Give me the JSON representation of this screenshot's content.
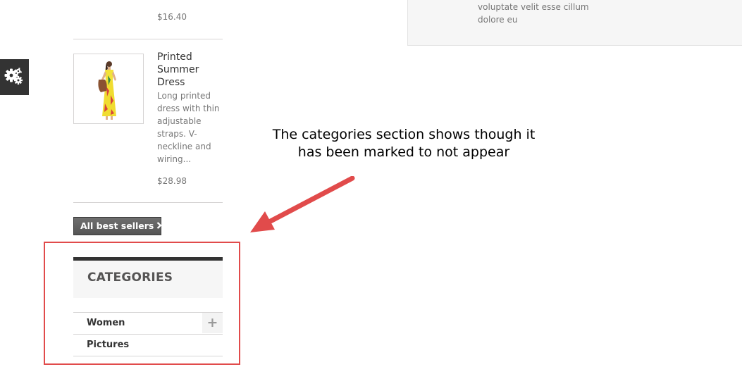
{
  "top_panel": {
    "text": "voluptate velit esse cillum dolore eu"
  },
  "prev_product": {
    "price": "$16.40"
  },
  "product": {
    "title": "Printed Summer Dress",
    "description": "Long printed dress with thin adjustable straps. V-neckline and wiring...",
    "price": "$28.98"
  },
  "best_sellers": {
    "button_label": "All best sellers"
  },
  "annotation": {
    "text": "The categories section shows though it has been marked to not appear"
  },
  "categories": {
    "title": "CATEGORIES",
    "items": [
      {
        "label": "Women",
        "expandable": true
      },
      {
        "label": "Pictures",
        "expandable": false
      }
    ]
  },
  "colors": {
    "annotation_red": "#e14b4b",
    "dark_bar": "#333333",
    "panel_gray": "#f6f6f6"
  },
  "icons": {
    "settings": "gears-icon",
    "expand": "plus-icon",
    "chevron": "chevron-right-icon"
  }
}
